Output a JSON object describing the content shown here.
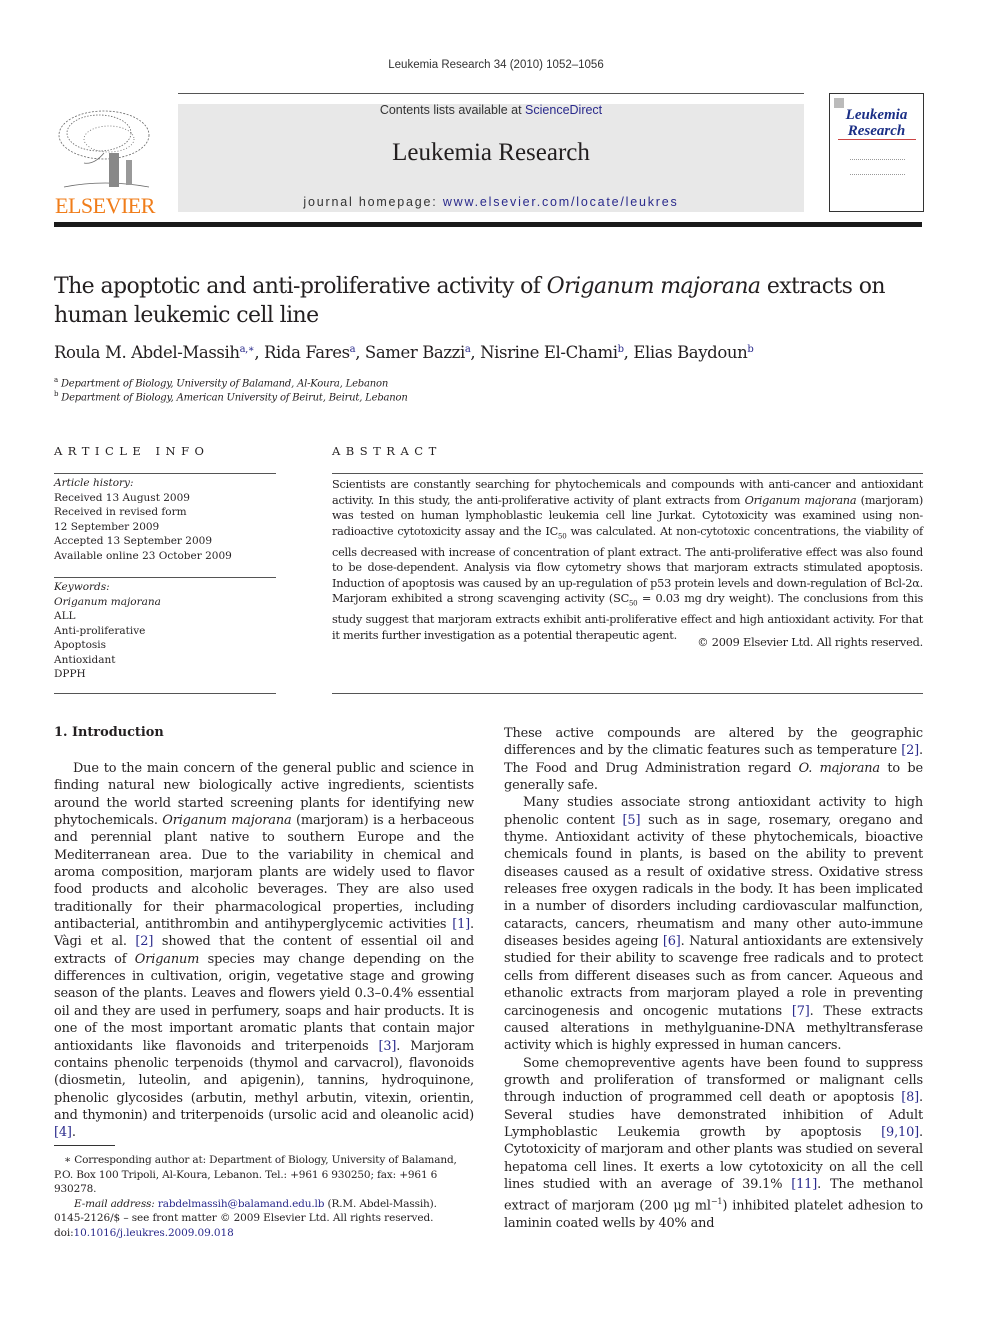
{
  "running_head": "Leukemia Research 34 (2010) 1052–1056",
  "masthead": {
    "contents_prefix": "Contents lists available at ",
    "contents_link": "ScienceDirect",
    "journal_title": "Leukemia Research",
    "homepage_prefix": "journal homepage: ",
    "homepage_link": "www.elsevier.com/locate/leukres",
    "publisher_logo_text": "ELSEVIER",
    "cover": {
      "title_line1": "Leukemia",
      "title_line2": "Research"
    }
  },
  "article": {
    "title_part1": "The apoptotic and anti-proliferative activity of ",
    "title_italic": "Origanum majorana",
    "title_part2": " extracts on human leukemic cell line",
    "authors": [
      {
        "name": "Roula M. Abdel-Massih",
        "sup": "a,∗",
        "sep": ", "
      },
      {
        "name": "Rida Fares",
        "sup": "a",
        "sep": ", "
      },
      {
        "name": "Samer Bazzi",
        "sup": "a",
        "sep": ", "
      },
      {
        "name": "Nisrine El-Chami",
        "sup": "b",
        "sep": ", "
      },
      {
        "name": "Elias Baydoun",
        "sup": "b",
        "sep": ""
      }
    ],
    "affiliations": [
      {
        "mark": "a",
        "text": "Department of Biology, University of Balamand, Al-Koura, Lebanon"
      },
      {
        "mark": "b",
        "text": "Department of Biology, American University of Beirut, Beirut, Lebanon"
      }
    ]
  },
  "article_info": {
    "label": "ARTICLE INFO",
    "history_label": "Article history:",
    "history": [
      "Received 13 August 2009",
      "Received in revised form",
      "12 September 2009",
      "Accepted 13 September 2009",
      "Available online 23 October 2009"
    ],
    "keywords_label": "Keywords:",
    "keywords": [
      "Origanum majorana",
      "ALL",
      "Anti-proliferative",
      "Apoptosis",
      "Antioxidant",
      "DPPH"
    ]
  },
  "abstract": {
    "label": "ABSTRACT",
    "t1": "Scientists are constantly searching for phytochemicals and compounds with anti-cancer and antioxidant activity. In this study, the anti-proliferative activity of plant extracts from ",
    "t1_italic": "Origanum majorana",
    "t2": " (marjoram) was tested on human lymphoblastic leukemia cell line Jurkat. Cytotoxicity was examined using non-radioactive cytotoxicity assay and the IC",
    "t2_sub": "50",
    "t3": " was calculated. At non-cytotoxic concentrations, the viability of cells decreased with increase of concentration of plant extract. The anti-proliferative effect was also found to be dose-dependent. Analysis via flow cytometry shows that marjoram extracts stimulated apoptosis. Induction of apoptosis was caused by an up-regulation of p53 protein levels and down-regulation of Bcl-2α. Marjoram exhibited a strong scavenging activity (SC",
    "t3_sub": "50",
    "t4": " = 0.03 mg dry weight). The conclusions from this study suggest that marjoram extracts exhibit anti-proliferative effect and high antioxidant activity. For that it merits further investigation as a potential therapeutic agent.",
    "copyright": "© 2009 Elsevier Ltd. All rights reserved."
  },
  "intro": {
    "heading": "1.  Introduction",
    "left": {
      "p1_a": "Due to the main concern of the general public and science in finding natural new biologically active ingredients, scientists around the world started screening plants for identifying new phytochemicals. ",
      "p1_i1": "Origanum majorana",
      "p1_b": " (marjoram) is a herbaceous and perennial plant native to southern Europe and the Mediterranean area. Due to the variability in chemical and aroma composition, marjoram plants are widely used to flavor food products and alcoholic beverages. They are also used traditionally for their pharmacological properties, including antibacterial, antithrombin and antihyperglycemic activities ",
      "c1": "[1]",
      "p1_c": ". Vàgi et al. ",
      "c2": "[2]",
      "p1_d": " showed that the content of essential oil and extracts of ",
      "p1_i2": "Origanum",
      "p1_e": " species may change depending on the differences in cultivation, origin, vegetative stage and growing season of the plants. Leaves and flowers yield 0.3–0.4% essential oil and they are used in perfumery, soaps and hair products. It is one of the most important aromatic plants that contain major antioxidants like flavonoids and triterpenoids ",
      "c3": "[3]",
      "p1_f": ". Marjoram contains phenolic terpenoids (thymol and carvacrol), flavonoids (diosmetin, luteolin, and apigenin), tannins, hydroquinone, phenolic glycosides (arbutin, methyl arbutin, vitexin, orientin, and thymonin) and triterpenoids (ursolic acid and oleanolic acid) ",
      "c4": "[4]",
      "p1_g": "."
    },
    "right": {
      "p1_a": "These active compounds are altered by the geographic differences and by the climatic features such as temperature ",
      "c2": "[2]",
      "p1_b": ". The Food and Drug Administration regard ",
      "p1_i": "O. majorana",
      "p1_c": " to be generally safe.",
      "p2_a": "Many studies associate strong antioxidant activity to high phenolic content ",
      "c5": "[5]",
      "p2_b": " such as in sage, rosemary, oregano and thyme. Antioxidant activity of these phytochemicals, bioactive chemicals found in plants, is based on the ability to prevent diseases caused as a result of oxidative stress. Oxidative stress releases free oxygen radicals in the body. It has been implicated in a number of disorders including cardiovascular malfunction, cataracts, cancers, rheumatism and many other auto-immune diseases besides ageing ",
      "c6": "[6]",
      "p2_c": ". Natural antioxidants are extensively studied for their ability to scavenge free radicals and to protect cells from different diseases such as from cancer. Aqueous and ethanolic extracts from marjoram played a role in preventing carcinogenesis and oncogenic mutations ",
      "c7": "[7]",
      "p2_d": ". These extracts caused alterations in methylguanine-DNA methyltransferase activity which is highly expressed in human cancers.",
      "p3_a": "Some chemopreventive agents have been found to suppress growth and proliferation of transformed or malignant cells through induction of programmed cell death or apoptosis ",
      "c8": "[8]",
      "p3_b": ". Several studies have demonstrated inhibition of Adult Lymphoblastic Leukemia growth by apoptosis ",
      "c9": "[9,10]",
      "p3_c": ". Cytotoxicity of marjoram and other plants was studied on several hepatoma cell lines. It exerts a low cytotoxicity on all the cell lines studied with an average of 39.1% ",
      "c11": "[11]",
      "p3_d": ". The methanol extract of marjoram (200 μg ml",
      "p3_sup": "−1",
      "p3_e": ") inhibited platelet adhesion to laminin coated wells by 40% and"
    }
  },
  "footnote": {
    "star": "∗",
    "corresponding": " Corresponding author at: Department of Biology, University of Balamand, P.O. Box 100 Tripoli, Al-Koura, Lebanon. Tel.: +961 6 930250; fax: +961 6 930278.",
    "email_label": "E-mail address: ",
    "email": "rabdelmassih@balamand.edu.lb",
    "email_suffix": " (R.M. Abdel-Massih)."
  },
  "front_matter": {
    "issn_line": "0145-2126/$ – see front matter © 2009 Elsevier Ltd. All rights reserved.",
    "doi_prefix": "doi:",
    "doi": "10.1016/j.leukres.2009.09.018"
  }
}
